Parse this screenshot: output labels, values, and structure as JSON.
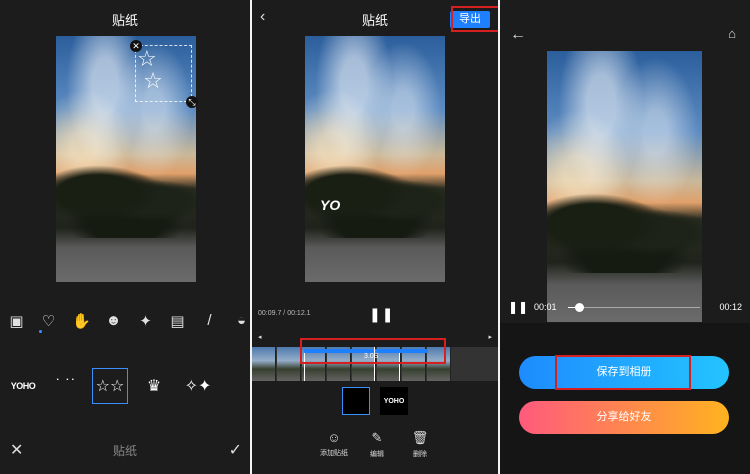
{
  "panel1": {
    "title": "贴纸",
    "categories": [
      "photo-sticker-icon",
      "heart-icon",
      "hand-icon",
      "cat-icon",
      "sparkle-icon",
      "stamp-icon",
      "pen-icon",
      "fruit-icon"
    ],
    "sticker_yoho": "YOHO",
    "bottom_label": "贴纸"
  },
  "panel2": {
    "title": "贴纸",
    "export_label": "导出",
    "yo_text": "YO",
    "timecode": "00:09.7 / 00:12.1",
    "segment_label": "3.0S",
    "thumb_yoho": "YOHO",
    "actions": [
      "添加贴纸",
      "编辑",
      "删除"
    ]
  },
  "panel3": {
    "current_time": "00:01",
    "total_time": "00:12",
    "progress_fraction": 0.08,
    "save_label": "保存到相册",
    "share_label": "分享给好友"
  },
  "colors": {
    "accent": "#1e7fff",
    "highlight": "#d42020",
    "share_gradient_start": "#ff5a7d",
    "share_gradient_end": "#ffb320"
  }
}
